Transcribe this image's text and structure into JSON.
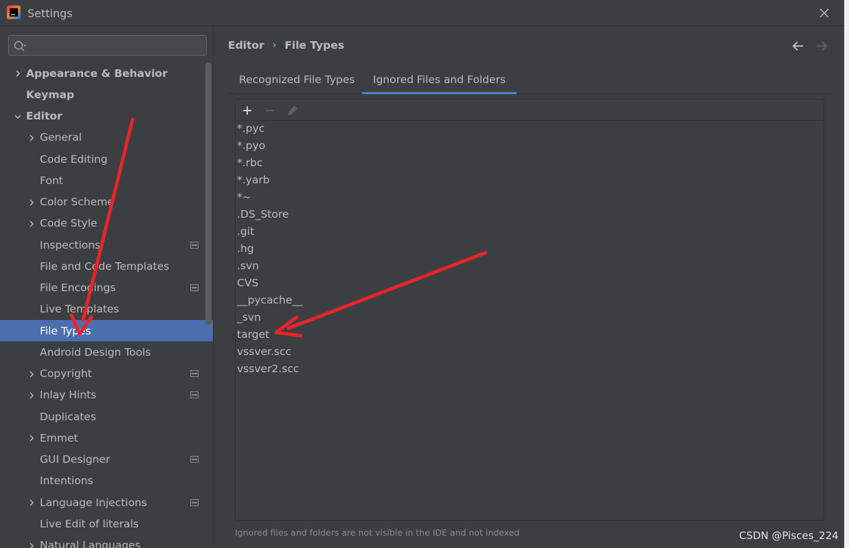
{
  "window": {
    "title": "Settings"
  },
  "search": {
    "placeholder": "",
    "value": ""
  },
  "sidebar": {
    "items": [
      {
        "label": "Appearance & Behavior",
        "bold": true,
        "expandable": true,
        "expanded": false,
        "indent": 0
      },
      {
        "label": "Keymap",
        "bold": true,
        "expandable": false,
        "indent": 0
      },
      {
        "label": "Editor",
        "bold": true,
        "expandable": true,
        "expanded": true,
        "indent": 0
      },
      {
        "label": "General",
        "expandable": true,
        "indent": 1
      },
      {
        "label": "Code Editing",
        "expandable": false,
        "indent": 1
      },
      {
        "label": "Font",
        "expandable": false,
        "indent": 1
      },
      {
        "label": "Color Scheme",
        "expandable": true,
        "indent": 1
      },
      {
        "label": "Code Style",
        "expandable": true,
        "indent": 1
      },
      {
        "label": "Inspections",
        "expandable": false,
        "indent": 1,
        "project_icon": true
      },
      {
        "label": "File and Code Templates",
        "expandable": false,
        "indent": 1
      },
      {
        "label": "File Encodings",
        "expandable": false,
        "indent": 1,
        "project_icon": true
      },
      {
        "label": "Live Templates",
        "expandable": false,
        "indent": 1
      },
      {
        "label": "File Types",
        "expandable": false,
        "indent": 1,
        "selected": true
      },
      {
        "label": "Android Design Tools",
        "expandable": false,
        "indent": 1
      },
      {
        "label": "Copyright",
        "expandable": true,
        "indent": 1,
        "project_icon": true
      },
      {
        "label": "Inlay Hints",
        "expandable": true,
        "indent": 1,
        "project_icon": true
      },
      {
        "label": "Duplicates",
        "expandable": false,
        "indent": 1
      },
      {
        "label": "Emmet",
        "expandable": true,
        "indent": 1
      },
      {
        "label": "GUI Designer",
        "expandable": false,
        "indent": 1,
        "project_icon": true
      },
      {
        "label": "Intentions",
        "expandable": false,
        "indent": 1
      },
      {
        "label": "Language Injections",
        "expandable": true,
        "indent": 1,
        "project_icon": true
      },
      {
        "label": "Live Edit of literals",
        "expandable": false,
        "indent": 1
      },
      {
        "label": "Natural Languages",
        "expandable": true,
        "indent": 1
      }
    ]
  },
  "breadcrumb": {
    "parent": "Editor",
    "separator": "›",
    "current": "File Types"
  },
  "tabs": [
    {
      "label": "Recognized File Types",
      "active": false
    },
    {
      "label": "Ignored Files and Folders",
      "active": true
    }
  ],
  "toolbar": {
    "add_icon": "plus-icon",
    "remove_icon": "minus-icon",
    "edit_icon": "pencil-icon"
  },
  "ignored_list": [
    "*.pyc",
    "*.pyo",
    "*.rbc",
    "*.yarb",
    "*~",
    ".DS_Store",
    ".git",
    ".hg",
    ".svn",
    "CVS",
    "__pycache__",
    "_svn",
    "target",
    "vssver.scc",
    "vssver2.scc"
  ],
  "hint": "Ignored files and folders are not visible in the IDE and not indexed",
  "watermark": "CSDN @Pisces_224",
  "colors": {
    "background": "#3c3f41",
    "selection": "#4b6eaf",
    "tab_underline": "#4a88c7",
    "annotation_arrow": "#e8242b"
  }
}
